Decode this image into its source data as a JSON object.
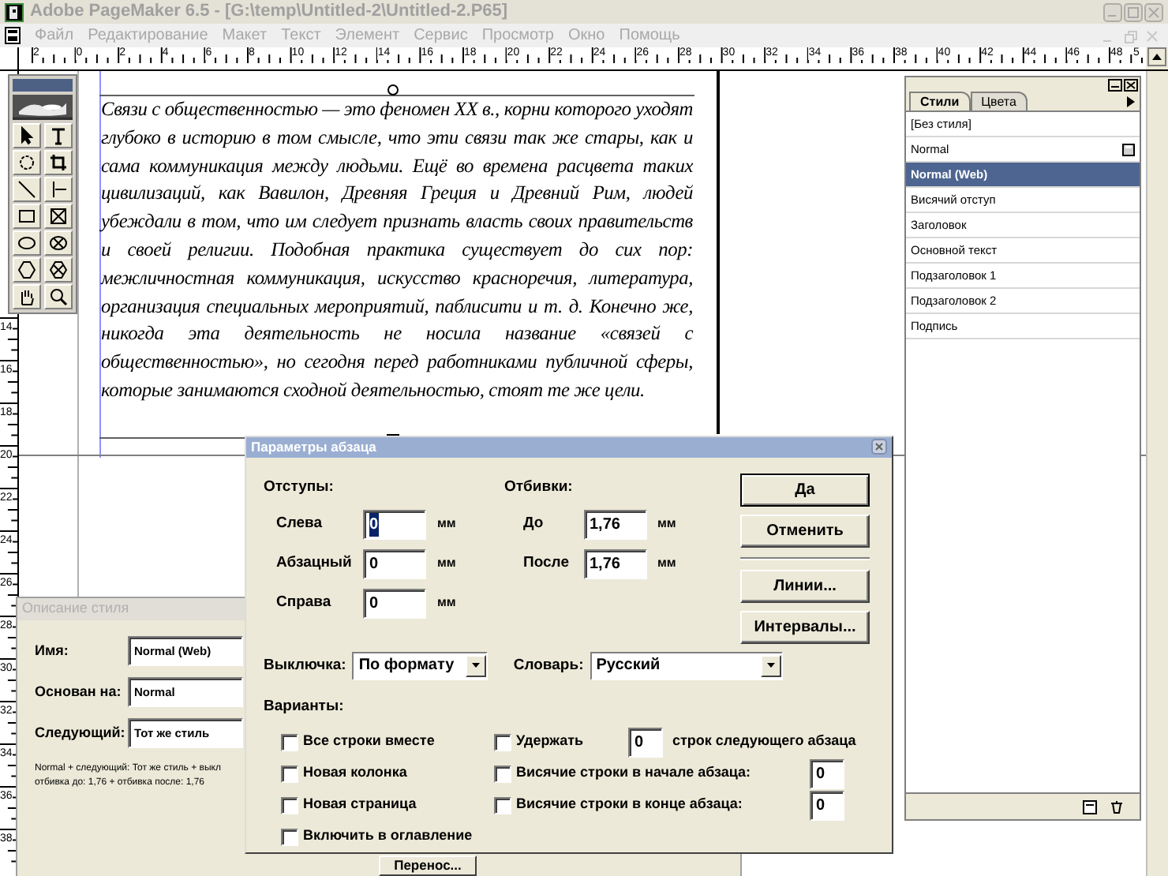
{
  "app": {
    "title": "Adobe PageMaker 6.5 - [G:\\temp\\Untitled-2\\Untitled-2.P65]"
  },
  "menu": [
    "Файл",
    "Редактирование",
    "Макет",
    "Текст",
    "Элемент",
    "Сервис",
    "Просмотр",
    "Окно",
    "Помощь"
  ],
  "ruler_h": [
    "2",
    "0",
    "2",
    "4",
    "6",
    "8",
    "10",
    "12",
    "14",
    "16",
    "18",
    "20",
    "22",
    "24",
    "26",
    "28",
    "30",
    "32",
    "34",
    "36",
    "38",
    "40",
    "42",
    "44",
    "46",
    "48",
    "5"
  ],
  "ruler_v": [
    "14",
    "16",
    "18",
    "20",
    "22",
    "24",
    "26",
    "28",
    "30",
    "32",
    "34",
    "36",
    "38"
  ],
  "document": {
    "text": "Связи с общественностью — это феномен XX в., корни которого уходят глубоко в историю в том смысле, что эти связи так же стары, как и сама коммуникация между людьми. Ещё во времена расцвета таких цивилизаций, как Вавилон, Древняя Греция и Древний Рим, людей убеждали в том, что им следует признать власть своих правительств и своей религии. Подобная практика существует до сих пор: межличностная коммуникация, искусство красноречия, литература, организация специальных мероприятий, паблисити и т. д. Конечно же, никогда эта деятельность не носила название «связей с общественностью», но сегодня перед работниками публичной сферы, которые занимаются сходной деятельностью, стоят те же цели."
  },
  "styles_palette": {
    "tabs": [
      {
        "label": "Стили",
        "selected": true
      },
      {
        "label": "Цвета",
        "selected": false
      }
    ],
    "items": [
      {
        "label": "[Без стиля]",
        "selected": false,
        "saved_icon": false
      },
      {
        "label": "Normal",
        "selected": false,
        "saved_icon": true
      },
      {
        "label": "Normal (Web)",
        "selected": true,
        "saved_icon": false
      },
      {
        "label": "Висячий отступ",
        "selected": false,
        "saved_icon": false
      },
      {
        "label": "Заголовок",
        "selected": false,
        "saved_icon": false
      },
      {
        "label": "Основной текст",
        "selected": false,
        "saved_icon": false
      },
      {
        "label": "Подзаголовок 1",
        "selected": false,
        "saved_icon": false
      },
      {
        "label": "Подзаголовок 2",
        "selected": false,
        "saved_icon": false
      },
      {
        "label": "Подпись",
        "selected": false,
        "saved_icon": false
      }
    ]
  },
  "style_window": {
    "title": "Описание стиля",
    "fields": [
      {
        "label": "Имя:",
        "value": "Normal (Web)"
      },
      {
        "label": "Основан на:",
        "value": "Normal"
      },
      {
        "label": "Следующий:",
        "value": "Тот же стиль"
      }
    ],
    "description": [
      "Normal + следующий: Тот же стиль + выкл",
      "отбивка до: 1,76 + отбивка после: 1,76"
    ],
    "button": "Перенос..."
  },
  "dialog": {
    "title": "Параметры абзаца",
    "indents": {
      "heading": "Отступы:",
      "rows": [
        {
          "label": "Слева",
          "value": "0",
          "unit": "мм",
          "text_selected": true
        },
        {
          "label": "Абзацный",
          "value": "0",
          "unit": "мм",
          "text_selected": false
        },
        {
          "label": "Справа",
          "value": "0",
          "unit": "мм",
          "text_selected": false
        }
      ]
    },
    "spacing": {
      "heading": "Отбивки:",
      "rows": [
        {
          "label": "До",
          "value": "1,76",
          "unit": "мм",
          "text_selected": false
        },
        {
          "label": "После",
          "value": "1,76",
          "unit": "мм",
          "text_selected": false
        }
      ]
    },
    "buttons": [
      {
        "label": "Да",
        "default": true
      },
      {
        "label": "Отменить",
        "default": false
      },
      {
        "label": "Линии...",
        "default": false
      },
      {
        "label": "Интервалы...",
        "default": false
      }
    ],
    "alignment": {
      "label": "Выключка:",
      "value": "По формату"
    },
    "dictionary": {
      "label": "Словарь:",
      "value": "Русский"
    },
    "options_heading": "Варианты:",
    "options_left": [
      {
        "label": "Все строки вместе",
        "checked": false
      },
      {
        "label": "Новая колонка",
        "checked": false
      },
      {
        "label": "Новая страница",
        "checked": false
      },
      {
        "label": "Включить в оглавление",
        "checked": false
      }
    ],
    "options_right": [
      {
        "label": "Удержать",
        "checked": false,
        "value": "0",
        "suffix": "строк следующего абзаца"
      },
      {
        "label": "Висячие строки в начале абзаца:",
        "checked": false,
        "value": "0"
      },
      {
        "label": "Висячие строки в конце абзаца:",
        "checked": false,
        "value": "0"
      }
    ]
  }
}
